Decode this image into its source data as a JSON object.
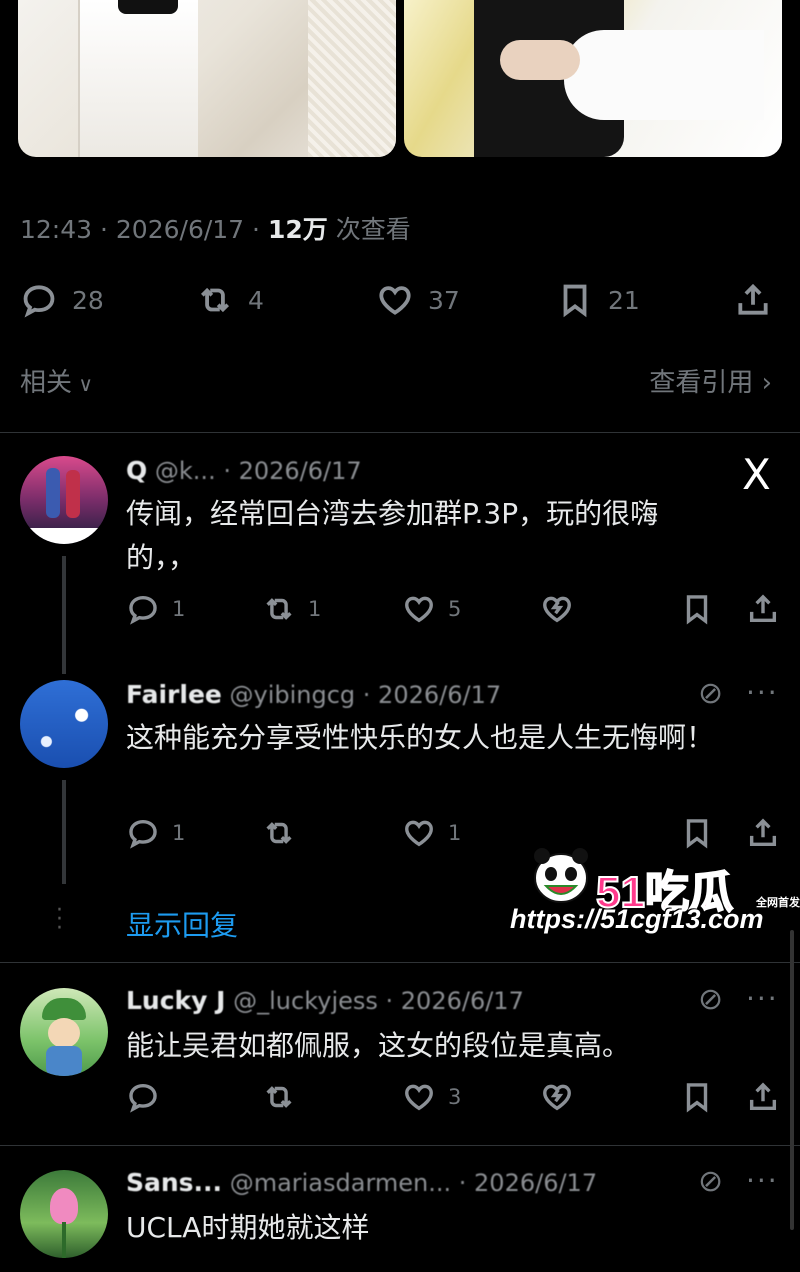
{
  "tweet": {
    "time": "12:43",
    "date": "2026/6/17",
    "views_count": "12万",
    "views_label": "次查看",
    "separator": "·"
  },
  "actions": {
    "reply_count": "28",
    "repost_count": "4",
    "like_count": "37",
    "bookmark_count": "21"
  },
  "related_label": "相关",
  "quotes_label": "查看引用",
  "replies": [
    {
      "name": "Q",
      "handle": "@k... · 2026/6/17",
      "text": "传闻，经常回台湾去参加群P.3P，玩的很嗨的，，",
      "reply_count": "1",
      "repost_count": "1",
      "like_count": "5"
    },
    {
      "name": "Fairlee",
      "handle": "@yibingcg · 2026/6/17",
      "text": "这种能充分享受性快乐的女人也是人生无悔啊！",
      "reply_count": "1",
      "repost_count": "",
      "like_count": "1"
    },
    {
      "name": "Lucky J",
      "handle": "@_luckyjess · 2026/6/17",
      "text": "能让吴君如都佩服，这女的段位是真高。",
      "reply_count": "",
      "repost_count": "",
      "like_count": "3"
    },
    {
      "name": "Sans...",
      "handle": "@mariasdarmen... · 2026/6/17",
      "text": "UCLA时期她就这样",
      "reply_count": "",
      "repost_count": "",
      "like_count": ""
    }
  ],
  "show_replies_label": "显示回复",
  "x_logo": "X",
  "icons": {
    "reply": "reply-icon",
    "repost": "repost-icon",
    "like": "heart-icon",
    "bookmark": "bookmark-icon",
    "share": "share-icon",
    "dislike": "broken-heart-icon",
    "grok": "slashed-circle-icon",
    "more": "more-icon"
  },
  "watermark": {
    "logo": "51吃瓜",
    "tag": "全网首发",
    "url": "https://51cgf13.com"
  },
  "colors": {
    "background": "#000000",
    "text": "#e7e9ea",
    "muted": "#71767b",
    "link": "#1d9bf0",
    "watermark_pink": "#ff3a8c"
  }
}
